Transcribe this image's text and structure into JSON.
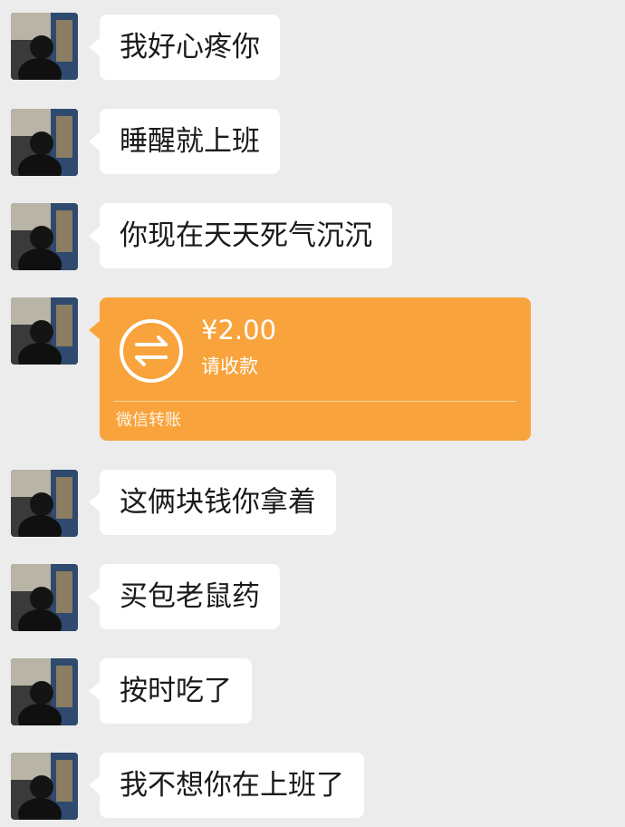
{
  "messages": [
    {
      "type": "text",
      "text": "我好心疼你"
    },
    {
      "type": "text",
      "text": "睡醒就上班"
    },
    {
      "type": "text",
      "text": "你现在天天死气沉沉"
    },
    {
      "type": "transfer",
      "amount": "¥2.00",
      "note": "请收款",
      "source": "微信转账",
      "icon": "transfer-arrows-icon",
      "color": "#f8a33c"
    },
    {
      "type": "text",
      "text": "这俩块钱你拿着"
    },
    {
      "type": "text",
      "text": "买包老鼠药"
    },
    {
      "type": "text",
      "text": "按时吃了"
    },
    {
      "type": "text",
      "text": "我不想你在上班了"
    }
  ]
}
